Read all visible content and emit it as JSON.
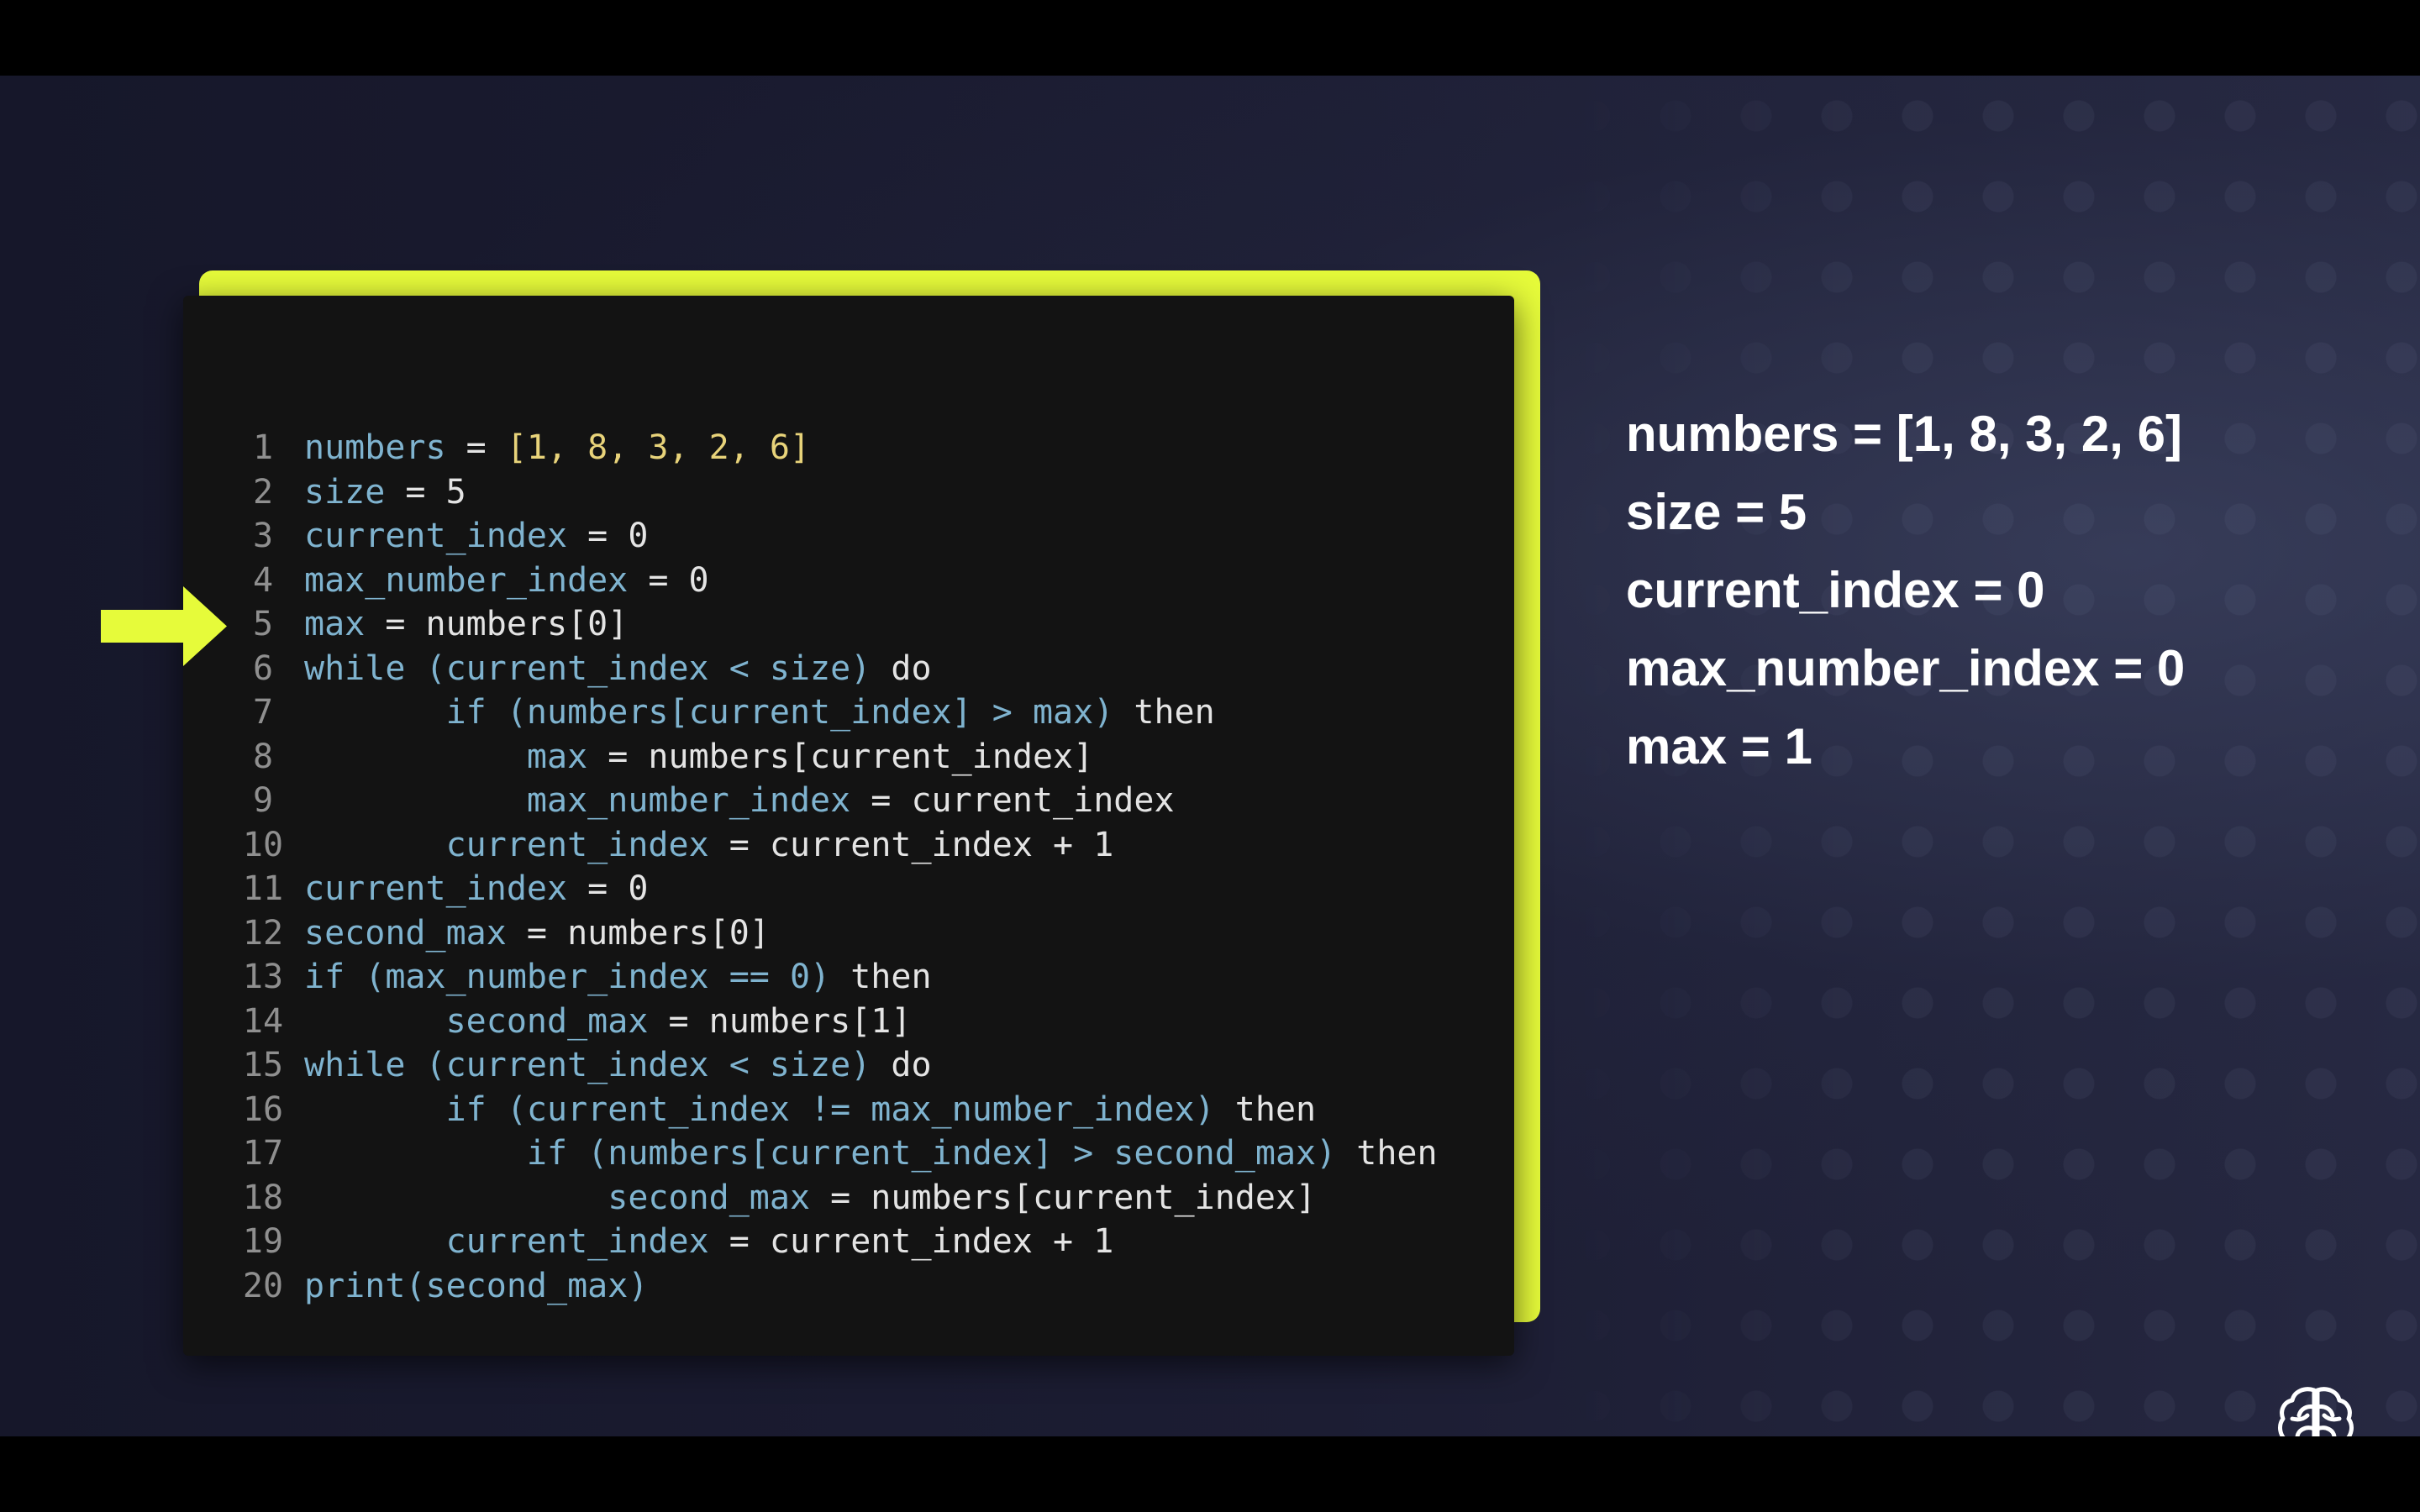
{
  "colors": {
    "accent": "#e6fb3a",
    "code_background": "#131313",
    "variable": "#7fb3cf",
    "number_literal": "#e8d37a",
    "plain_text": "#e4e4e4",
    "line_number": "#8f8f8f",
    "state_text": "#ffffff"
  },
  "current_line_indicator": {
    "icon": "arrow-right-icon",
    "line": 5
  },
  "code": {
    "lines": [
      {
        "number": "1",
        "segments": [
          {
            "t": "numbers",
            "k": "var"
          },
          {
            "t": " = ",
            "k": "ws"
          },
          {
            "t": "[1, 8, 3, 2, 6]",
            "k": "num"
          }
        ]
      },
      {
        "number": "2",
        "segments": [
          {
            "t": "size",
            "k": "var"
          },
          {
            "t": " = 5",
            "k": "ws"
          }
        ]
      },
      {
        "number": "3",
        "segments": [
          {
            "t": "current_index",
            "k": "var"
          },
          {
            "t": " = 0",
            "k": "ws"
          }
        ]
      },
      {
        "number": "4",
        "segments": [
          {
            "t": "max_number_index",
            "k": "var"
          },
          {
            "t": " = 0",
            "k": "ws"
          }
        ]
      },
      {
        "number": "5",
        "segments": [
          {
            "t": "max",
            "k": "var"
          },
          {
            "t": " = numbers[0]",
            "k": "ws"
          }
        ]
      },
      {
        "number": "6",
        "segments": [
          {
            "t": "while (current_index < size)",
            "k": "var"
          },
          {
            "t": " do",
            "k": "kw"
          }
        ]
      },
      {
        "number": "7",
        "segments": [
          {
            "t": "       ",
            "k": "ws"
          },
          {
            "t": "if (numbers[current_index] > max)",
            "k": "var"
          },
          {
            "t": " then",
            "k": "kw"
          }
        ]
      },
      {
        "number": "8",
        "segments": [
          {
            "t": "           ",
            "k": "ws"
          },
          {
            "t": "max",
            "k": "var"
          },
          {
            "t": " = numbers[current_index]",
            "k": "ws"
          }
        ]
      },
      {
        "number": "9",
        "segments": [
          {
            "t": "           ",
            "k": "ws"
          },
          {
            "t": "max_number_index",
            "k": "var"
          },
          {
            "t": " = current_index",
            "k": "ws"
          }
        ]
      },
      {
        "number": "10",
        "segments": [
          {
            "t": "       ",
            "k": "ws"
          },
          {
            "t": "current_index",
            "k": "var"
          },
          {
            "t": " = current_index + 1",
            "k": "ws"
          }
        ]
      },
      {
        "number": "11",
        "segments": [
          {
            "t": "current_index",
            "k": "var"
          },
          {
            "t": " = 0",
            "k": "ws"
          }
        ]
      },
      {
        "number": "12",
        "segments": [
          {
            "t": "second_max",
            "k": "var"
          },
          {
            "t": " = numbers[0]",
            "k": "ws"
          }
        ]
      },
      {
        "number": "13",
        "segments": [
          {
            "t": "if (max_number_index == 0)",
            "k": "var"
          },
          {
            "t": " then",
            "k": "kw"
          }
        ]
      },
      {
        "number": "14",
        "segments": [
          {
            "t": "       ",
            "k": "ws"
          },
          {
            "t": "second_max",
            "k": "var"
          },
          {
            "t": " = numbers[1]",
            "k": "ws"
          }
        ]
      },
      {
        "number": "15",
        "segments": [
          {
            "t": "while (current_index < size)",
            "k": "var"
          },
          {
            "t": " do",
            "k": "kw"
          }
        ]
      },
      {
        "number": "16",
        "segments": [
          {
            "t": "       ",
            "k": "ws"
          },
          {
            "t": "if (current_index != max_number_index)",
            "k": "var"
          },
          {
            "t": " then",
            "k": "kw"
          }
        ]
      },
      {
        "number": "17",
        "segments": [
          {
            "t": "           ",
            "k": "ws"
          },
          {
            "t": "if (numbers[current_index] > second_max)",
            "k": "var"
          },
          {
            "t": " then",
            "k": "kw"
          }
        ]
      },
      {
        "number": "18",
        "segments": [
          {
            "t": "               ",
            "k": "ws"
          },
          {
            "t": "second_max",
            "k": "var"
          },
          {
            "t": " = numbers[current_index]",
            "k": "ws"
          }
        ]
      },
      {
        "number": "19",
        "segments": [
          {
            "t": "       ",
            "k": "ws"
          },
          {
            "t": "current_index",
            "k": "var"
          },
          {
            "t": " = current_index + 1",
            "k": "ws"
          }
        ]
      },
      {
        "number": "20",
        "segments": [
          {
            "t": "print(second_max)",
            "k": "var"
          }
        ]
      }
    ]
  },
  "variable_state": {
    "lines": [
      "numbers = [1, 8, 3, 2, 6]",
      "size = 5",
      "current_index = 0",
      "max_number_index = 0",
      "max = 1"
    ]
  },
  "logo": {
    "icon": "brain-logo-icon"
  }
}
